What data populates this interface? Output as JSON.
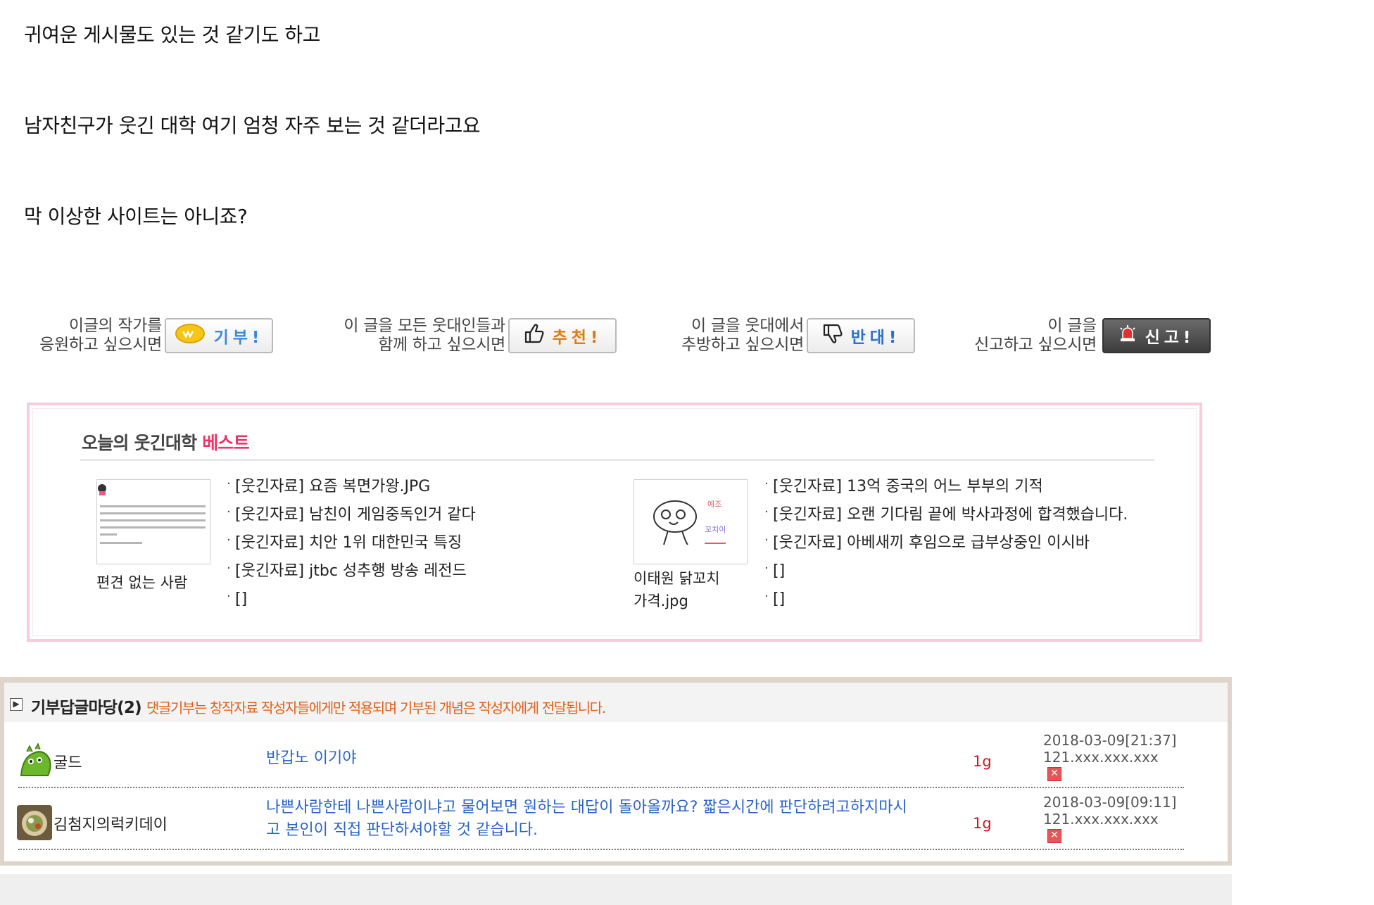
{
  "post": {
    "lines": [
      "귀여운 게시물도 있는 것 같기도 하고",
      "남자친구가 웃긴 대학 여기 엄청 자주 보는 것 같더라고요",
      "막 이상한 사이트는 아니죠?"
    ]
  },
  "actions": {
    "donate": {
      "text1": "이글의 작가를",
      "text2": "응원하고 싶으시면",
      "button": "기부!",
      "icon": "coin-icon"
    },
    "recommend": {
      "text1": "이 글을 모든 웃대인들과",
      "text2": "함께 하고 싶으시면",
      "button": "추천!",
      "icon": "thumbs-up-icon"
    },
    "oppose": {
      "text1": "이 글을 웃대에서",
      "text2": "추방하고 싶으시면",
      "button": "반대!",
      "icon": "thumbs-down-icon"
    },
    "report": {
      "text1": "이 글을",
      "text2": "신고하고 싶으시면",
      "button": "신고!",
      "icon": "siren-icon"
    }
  },
  "best": {
    "title": "오늘의 웃긴대학",
    "title_highlight": "베스트",
    "left": {
      "caption": "편견 없는 사람",
      "items": [
        "[웃긴자료] 요즘 복면가왕.JPG",
        "[웃긴자료] 남친이 게임중독인거 같다",
        "[웃긴자료] 치안 1위 대한민국 특징",
        "[웃긴자료] jtbc 성추행 방송 레전드",
        "[]"
      ]
    },
    "right": {
      "caption_line1": "이태원 닭꼬치",
      "caption_line2": "가격.jpg",
      "items": [
        "[웃긴자료] 13억 중국의 어느 부부의 기적",
        "[웃긴자료] 오랜 기다림 끝에 박사과정에 합격했습니다.",
        "[웃긴자료] 아베새끼 후임으로 급부상중인 이시바",
        "[]",
        "[]"
      ]
    }
  },
  "comments": {
    "title": "기부답글마당(2)",
    "note": "댓글기부는 창작자료 작성자들에게만 적용되며 기부된 개념은 작성자에게 전달됩니다.",
    "rows": [
      {
        "nick": "굴드",
        "message_line1": "반갑노 이기야",
        "message_line2": "",
        "points": "1g",
        "date": "2018-03-09[21:37]",
        "ip": "121.xxx.xxx.xxx"
      },
      {
        "nick": "김첨지의럭키데이",
        "message_line1": "나쁜사람한테 나쁜사람이냐고 물어보면 원하는 대답이 돌아올까요? 짧은시간에 판단하려고하지마시",
        "message_line2": "고 본인이 직접 판단하셔야할 것 같습니다.",
        "points": "1g",
        "date": "2018-03-09[09:11]",
        "ip": "121.xxx.xxx.xxx"
      }
    ]
  }
}
